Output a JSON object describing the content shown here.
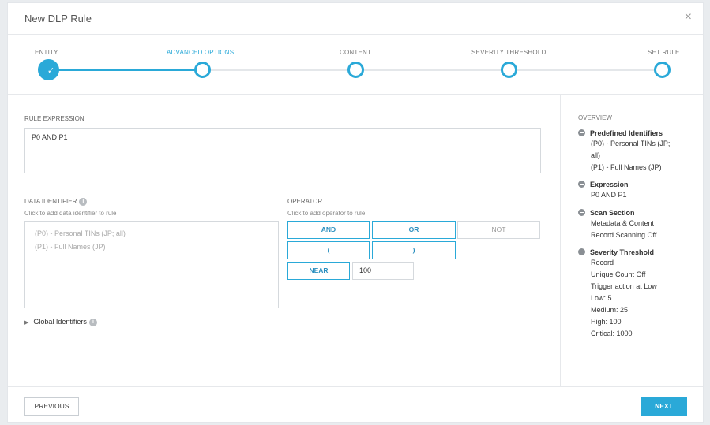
{
  "dialog": {
    "title": "New DLP Rule",
    "close_glyph": "×"
  },
  "steps": [
    {
      "label": "ENTITY",
      "state": "done"
    },
    {
      "label": "ADVANCED OPTIONS",
      "state": "active"
    },
    {
      "label": "CONTENT",
      "state": "pending"
    },
    {
      "label": "SEVERITY THRESHOLD",
      "state": "pending"
    },
    {
      "label": "SET RULE",
      "state": "pending"
    }
  ],
  "rule_expression": {
    "label": "RULE EXPRESSION",
    "value": "P0 AND P1"
  },
  "data_identifier": {
    "label": "DATA IDENTIFIER",
    "hint": "Click to add data identifier to rule",
    "items": [
      "(P0) - Personal TINs (JP; all)",
      "(P1) - Full Names (JP)"
    ]
  },
  "operator": {
    "label": "OPERATOR",
    "hint": "Click to add operator to rule",
    "and": "AND",
    "or": "OR",
    "not": "NOT",
    "open_paren": "(",
    "close_paren": ")",
    "near": "NEAR",
    "near_value": "100"
  },
  "global_identifiers": {
    "label": "Global Identifiers"
  },
  "overview": {
    "title": "OVERVIEW",
    "predefined": {
      "heading": "Predefined Identifiers",
      "lines": [
        "(P0) - Personal TINs (JP;",
        "all)",
        "(P1) - Full Names (JP)"
      ]
    },
    "expression": {
      "heading": "Expression",
      "lines": [
        "P0 AND P1"
      ]
    },
    "scan": {
      "heading": "Scan Section",
      "lines": [
        "Metadata & Content",
        "Record Scanning Off"
      ]
    },
    "severity": {
      "heading": "Severity Threshold",
      "lines": [
        "Record",
        "Unique Count Off",
        "Trigger action at Low",
        "Low: 5",
        "Medium: 25",
        "High: 100",
        "Critical: 1000"
      ]
    }
  },
  "footer": {
    "previous_label": "PREVIOUS",
    "next_label": "NEXT"
  },
  "colors": {
    "accent": "#2aa9d8"
  }
}
